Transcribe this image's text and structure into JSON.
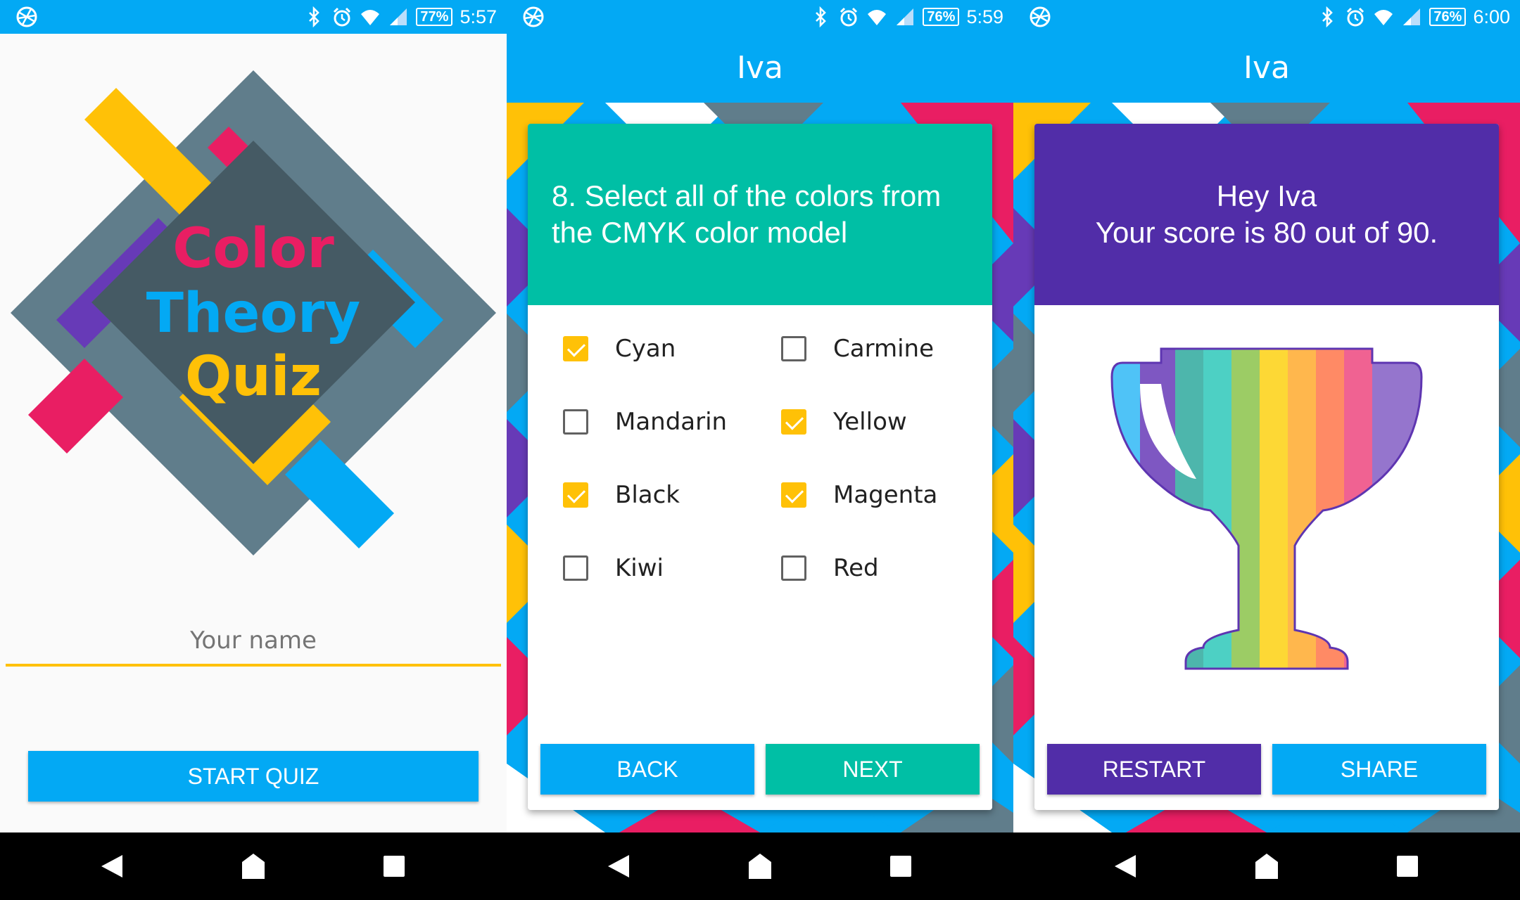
{
  "colors": {
    "primary_blue": "#03a9f4",
    "teal": "#00bfa5",
    "purple": "#512da8",
    "yellow": "#ffc107",
    "pink": "#e91e63",
    "slate": "#607d8b",
    "violet": "#673ab7"
  },
  "screen1": {
    "status": {
      "battery": "77%",
      "time": "5:57"
    },
    "logo": {
      "line1": "Color",
      "line2": "Theory",
      "line3": "Quiz"
    },
    "name_placeholder": "Your name",
    "start_label": "START QUIZ"
  },
  "screen2": {
    "status": {
      "battery": "76%",
      "time": "5:59"
    },
    "title": "Iva",
    "question": "8. Select all of the colors from the CMYK color model",
    "options": [
      {
        "label": "Cyan",
        "checked": true
      },
      {
        "label": "Carmine",
        "checked": false
      },
      {
        "label": "Mandarin",
        "checked": false
      },
      {
        "label": "Yellow",
        "checked": true
      },
      {
        "label": "Black",
        "checked": true
      },
      {
        "label": "Magenta",
        "checked": true
      },
      {
        "label": "Kiwi",
        "checked": false
      },
      {
        "label": "Red",
        "checked": false
      }
    ],
    "back_label": "BACK",
    "next_label": "NEXT"
  },
  "screen3": {
    "status": {
      "battery": "76%",
      "time": "6:00"
    },
    "title": "Iva",
    "greeting": "Hey Iva",
    "score_text": "Your score is 80 out of 90.",
    "restart_label": "RESTART",
    "share_label": "SHARE"
  },
  "icons": [
    "app-icon",
    "bluetooth-icon",
    "alarm-icon",
    "wifi-icon",
    "signal-icon",
    "battery-icon",
    "back-icon",
    "home-icon",
    "recents-icon",
    "check-icon",
    "trophy-icon"
  ]
}
